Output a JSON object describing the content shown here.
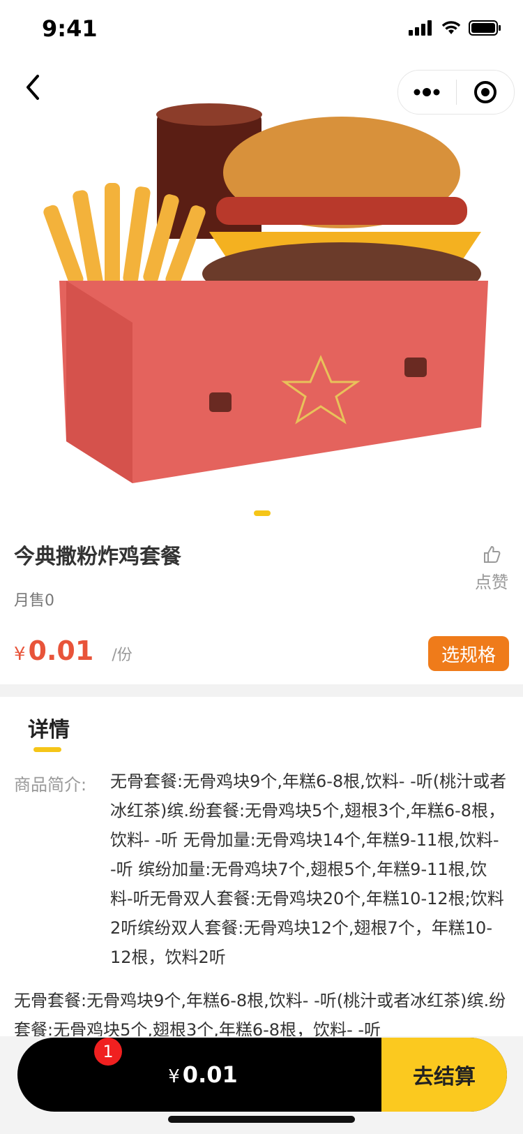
{
  "status_bar": {
    "time": "9:41"
  },
  "product": {
    "title": "今典撒粉炸鸡套餐",
    "monthly_sales": "月售0",
    "like_label": "点赞",
    "price_symbol": "¥",
    "price_value": "0.01",
    "price_unit": "/份",
    "select_spec_label": "选规格"
  },
  "details": {
    "tab_label": "详情",
    "intro_label": "商品简介:",
    "intro_text": "无骨套餐:无骨鸡块9个,年糕6-8根,饮料- -听(桃汁或者冰红茶)缤.纷套餐:无骨鸡块5个,翅根3个,年糕6-8根，饮料- -听 无骨加量:无骨鸡块14个,年糕9-11根,饮料- -听 缤纷加量:无骨鸡块7个,翅根5个,年糕9-11根,饮料-听无骨双人套餐:无骨鸡块20个,年糕10-12根;饮料2听缤纷双人套餐:无骨鸡块12个,翅根7个，年糕10-12根，饮料2听",
    "extra_text": "无骨套餐:无骨鸡块9个,年糕6-8根,饮料- -听(桃汁或者冰红茶)缤.纷套餐:无骨鸡块5个,翅根3个,年糕6-8根，饮料- -听"
  },
  "cart": {
    "badge_count": "1",
    "total_symbol": "¥",
    "total_value": "0.01",
    "checkout_label": "去结算"
  },
  "icons": {
    "back": "chevron-left-icon",
    "more": "more-dots-icon",
    "close_miniprogram": "target-icon",
    "like": "thumb-up-icon"
  },
  "colors": {
    "accent_yellow": "#f5c518",
    "price_red": "#e8543a",
    "spec_orange": "#ef7b1a",
    "checkout_yellow": "#fbc91f"
  }
}
